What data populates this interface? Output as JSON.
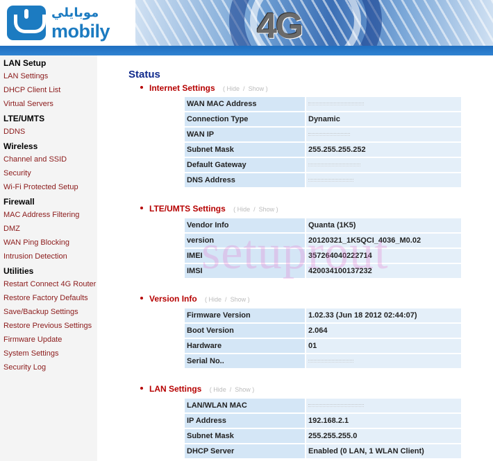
{
  "header": {
    "logo_arabic": "موبايلي",
    "logo_text": "mobily",
    "banner_text": "4G"
  },
  "colors": {
    "brand_blue": "#1c7bc1",
    "bar_blue": "#2576c6",
    "section_red": "#b60000",
    "title_navy": "#102a8c",
    "link_maroon": "#8b1a1a",
    "cell_label_bg": "#d4e6f6",
    "cell_value_bg": "#e4eff9"
  },
  "sidebar": {
    "groups": [
      {
        "title": "LAN Setup",
        "items": [
          "LAN Settings",
          "DHCP Client List",
          "Virtual Servers"
        ]
      },
      {
        "title": "LTE/UMTS",
        "items": [
          "DDNS"
        ]
      },
      {
        "title": "Wireless",
        "items": [
          "Channel and SSID",
          "Security",
          "Wi-Fi Protected Setup"
        ]
      },
      {
        "title": "Firewall",
        "items": [
          "MAC Address Filtering",
          "DMZ",
          "WAN Ping Blocking",
          "Intrusion Detection"
        ]
      },
      {
        "title": "Utilities",
        "items": [
          "Restart Connect 4G Router",
          "Restore Factory Defaults",
          "Save/Backup Settings",
          "Restore Previous Settings",
          "Firmware Update",
          "System Settings",
          "Security Log"
        ]
      }
    ]
  },
  "main": {
    "title": "Status",
    "hide_label": "Hide",
    "separator": "/",
    "show_label": "Show",
    "sections": [
      {
        "title": "Internet Settings",
        "rows": [
          {
            "label": "WAN MAC Address",
            "value": ""
          },
          {
            "label": "Connection Type",
            "value": "Dynamic"
          },
          {
            "label": "WAN IP",
            "value": ""
          },
          {
            "label": "Subnet Mask",
            "value": "255.255.255.252"
          },
          {
            "label": "Default Gateway",
            "value": ""
          },
          {
            "label": "DNS Address",
            "value": ""
          }
        ]
      },
      {
        "title": "LTE/UMTS Settings",
        "rows": [
          {
            "label": "Vendor Info",
            "value": "Quanta (1K5)"
          },
          {
            "label": "version",
            "value": "20120321_1K5QCI_4036_M0.02"
          },
          {
            "label": "IMEI",
            "value": "357264040222714"
          },
          {
            "label": "IMSI",
            "value": "420034100137232"
          }
        ]
      },
      {
        "title": "Version Info",
        "rows": [
          {
            "label": "Firmware Version",
            "value": "1.02.33 (Jun 18 2012 02:44:07)"
          },
          {
            "label": "Boot Version",
            "value": "2.064"
          },
          {
            "label": "Hardware",
            "value": "01"
          },
          {
            "label": "Serial No..",
            "value": ""
          }
        ]
      },
      {
        "title": "LAN Settings",
        "rows": [
          {
            "label": "LAN/WLAN MAC",
            "value": ""
          },
          {
            "label": "IP Address",
            "value": "192.168.2.1"
          },
          {
            "label": "Subnet Mask",
            "value": "255.255.255.0"
          },
          {
            "label": "DHCP Server",
            "value": "Enabled (0 LAN, 1 WLAN Client)"
          }
        ]
      }
    ]
  },
  "watermark": "setuprout"
}
